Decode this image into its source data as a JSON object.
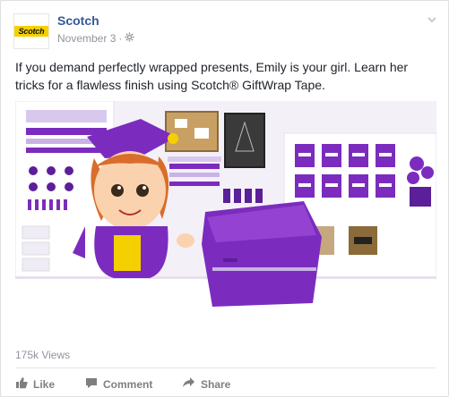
{
  "post": {
    "page_name": "Scotch",
    "logo_text": "Scotch",
    "date": "November 3",
    "separator": "·",
    "text": "If you demand perfectly wrapped presents, Emily is your girl. Learn her tricks for a flawless finish using Scotch® GiftWrap Tape.",
    "views": "175k Views"
  },
  "actions": {
    "like": "Like",
    "comment": "Comment",
    "share": "Share"
  },
  "colors": {
    "page_name": "#365899",
    "meta": "#90949c",
    "text": "#1d2129",
    "logo_yellow": "#f5d000",
    "purple": "#7b2cbf",
    "lavender": "#c9b3e6"
  },
  "icons": {
    "globe": "globe-icon",
    "chevron": "chevron-down-icon",
    "like": "thumbs-up-icon",
    "comment": "comment-icon",
    "share": "share-arrow-icon"
  }
}
